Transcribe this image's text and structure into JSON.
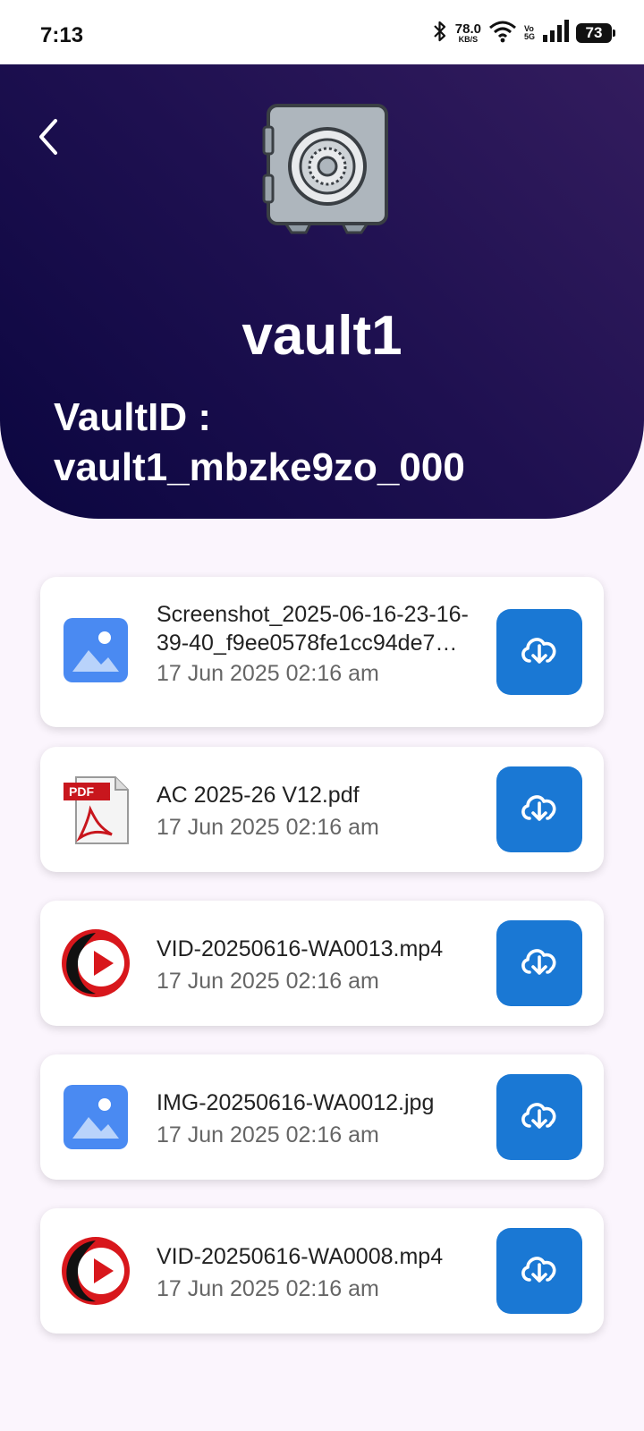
{
  "status_bar": {
    "time": "7:13",
    "net_speed": "78.0",
    "net_unit": "KB/S",
    "volte_top": "Vo",
    "volte_bottom": "5G",
    "battery": "73"
  },
  "vault": {
    "name": "vault1",
    "id_label": "VaultID :",
    "id_value": "vault1_mbzke9zo_000"
  },
  "files": [
    {
      "type": "image",
      "name": "Screenshot_2025-06-16-23-16-39-40_f9ee0578fe1cc94de7…",
      "date": "17 Jun 2025 02:16 am"
    },
    {
      "type": "pdf",
      "name": "AC 2025-26 V12.pdf",
      "date": "17 Jun 2025 02:16 am"
    },
    {
      "type": "video",
      "name": "VID-20250616-WA0013.mp4",
      "date": "17 Jun 2025 02:16 am"
    },
    {
      "type": "image",
      "name": "IMG-20250616-WA0012.jpg",
      "date": "17 Jun 2025 02:16 am"
    },
    {
      "type": "video",
      "name": "VID-20250616-WA0008.mp4",
      "date": "17 Jun 2025 02:16 am"
    }
  ],
  "pdf_icon_label": "PDF",
  "colors": {
    "accent": "#1a78d4",
    "hero_dark": "#0b0640",
    "hero_light": "#331c5e",
    "image_icon": "#4a8af2",
    "video_icon": "#d8171c"
  },
  "icons": {
    "back": "chevron-left-icon",
    "vault": "safe-icon",
    "download": "cloud-download-icon"
  }
}
